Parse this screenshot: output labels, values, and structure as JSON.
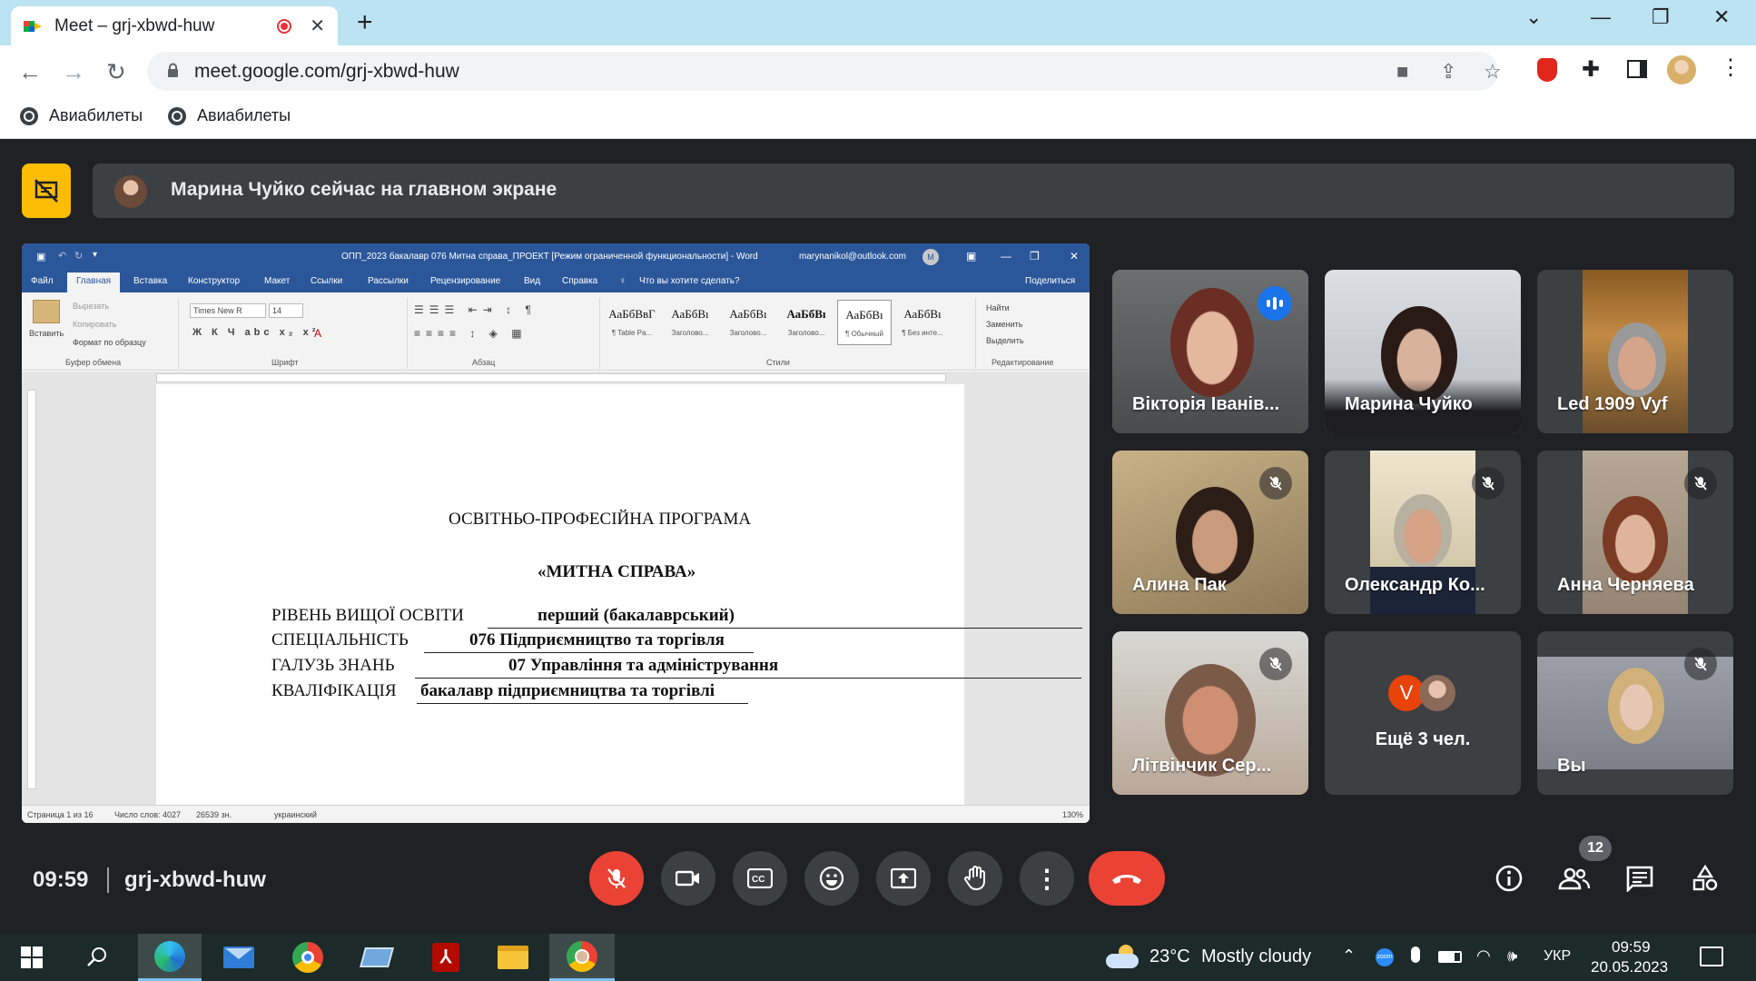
{
  "browser": {
    "tab_title": "Meet – grj-xbwd-huw",
    "url": "meet.google.com/grj-xbwd-huw",
    "bookmarks": [
      {
        "label": "Авиабилеты"
      },
      {
        "label": "Авиабилеты"
      }
    ]
  },
  "banner": {
    "text": "Марина Чуйко сейчас на главном экране"
  },
  "word": {
    "title": "ОПП_2023 бакалавр 076 Митна справа_ПРОЕКТ [Режим ограниченной функциональности]  -  Word",
    "account": "marynanikol@outlook.com",
    "account_initial": "M",
    "tabs": [
      "Файл",
      "Главная",
      "Вставка",
      "Конструктор",
      "Макет",
      "Ссылки",
      "Рассылки",
      "Рецензирование",
      "Вид",
      "Справка",
      "Что вы хотите сделать?",
      "Поделиться"
    ],
    "clipboard": {
      "paste": "Вставить",
      "cut": "Вырезать",
      "copy": "Копировать",
      "format": "Формат по образцу",
      "group": "Буфер обмена"
    },
    "font": {
      "name": "Times New R",
      "size": "14",
      "group": "Шрифт"
    },
    "paragraph_group": "Абзац",
    "styles": [
      {
        "sample": "АаБбВвГ",
        "name": "¶ Table Pa..."
      },
      {
        "sample": "АаБбВı",
        "name": "Заголово..."
      },
      {
        "sample": "АаБбВı",
        "name": "Заголово..."
      },
      {
        "sample": "АаБбВı",
        "name": "Заголово..."
      },
      {
        "sample": "АаБбВı",
        "name": "¶ Обычный"
      },
      {
        "sample": "АаБбВı",
        "name": "¶ Без инте..."
      }
    ],
    "styles_group": "Стили",
    "editing": {
      "find": "Найти",
      "replace": "Заменить",
      "select": "Выделить",
      "group": "Редактирование"
    },
    "document": {
      "heading1": "ОСВІТНЬО-ПРОФЕСІЙНА ПРОГРАМА",
      "heading2": "«МИТНА СПРАВА»",
      "rows": [
        {
          "label": "РІВЕНЬ ВИЩОЇ ОСВІТИ",
          "value": "перший (бакалаврський)"
        },
        {
          "label": "СПЕЦІАЛЬНІСТЬ",
          "value": "076 Підприємництво та торгівля"
        },
        {
          "label": "ГАЛУЗЬ ЗНАНЬ",
          "value": "07 Управління та адміністрування"
        },
        {
          "label": "КВАЛІФІКАЦІЯ",
          "value": "бакалавр підприємництва та торгівлі"
        }
      ]
    },
    "status": {
      "page": "Страница 1 из 16",
      "words": "Число слов: 4027",
      "chars": "26539 зн.",
      "language": "украинский",
      "zoom": "130%"
    }
  },
  "participants": [
    {
      "name": "Вікторія Іванів...",
      "state": "speaking"
    },
    {
      "name": "Марина Чуйко",
      "state": "presenting"
    },
    {
      "name": "Led 1909 Vyf",
      "state": "unmuted"
    },
    {
      "name": "Алина Пак",
      "state": "muted"
    },
    {
      "name": "Олександр Ко...",
      "state": "muted"
    },
    {
      "name": "Анна Черняева",
      "state": "muted"
    },
    {
      "name": "Літвінчик Сер...",
      "state": "muted"
    },
    {
      "name": "Ещё 3 чел.",
      "state": "overflow",
      "initial": "V"
    },
    {
      "name": "Вы",
      "state": "muted"
    }
  ],
  "bottom_bar": {
    "time": "09:59",
    "meeting_code": "grj-xbwd-huw",
    "participant_count": "12"
  },
  "taskbar": {
    "temperature": "23°C",
    "weather": "Mostly cloudy",
    "language": "УКР",
    "time": "09:59",
    "date": "20.05.2023"
  }
}
